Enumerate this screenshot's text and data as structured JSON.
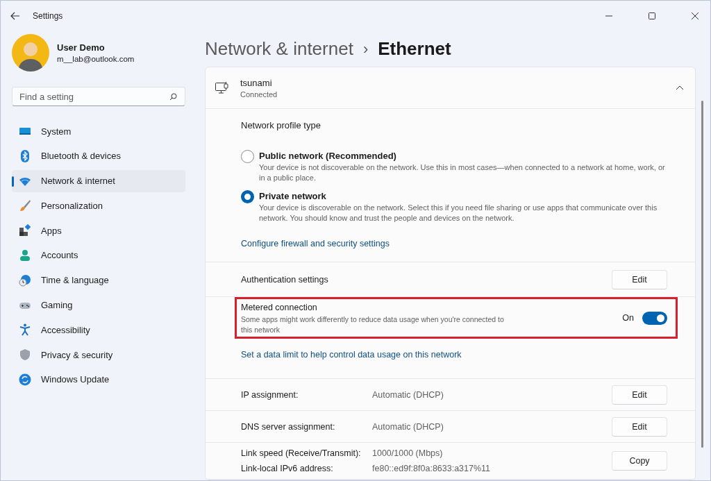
{
  "window": {
    "title": "Settings"
  },
  "user": {
    "name": "User Demo",
    "email": "m__lab@outlook.com"
  },
  "search": {
    "placeholder": "Find a setting"
  },
  "nav": [
    {
      "kind": "system",
      "label": "System",
      "selected": false
    },
    {
      "kind": "bluetooth",
      "label": "Bluetooth & devices",
      "selected": false
    },
    {
      "kind": "network",
      "label": "Network & internet",
      "selected": true
    },
    {
      "kind": "personalization",
      "label": "Personalization",
      "selected": false
    },
    {
      "kind": "apps",
      "label": "Apps",
      "selected": false
    },
    {
      "kind": "accounts",
      "label": "Accounts",
      "selected": false
    },
    {
      "kind": "time",
      "label": "Time & language",
      "selected": false
    },
    {
      "kind": "gaming",
      "label": "Gaming",
      "selected": false
    },
    {
      "kind": "accessibility",
      "label": "Accessibility",
      "selected": false
    },
    {
      "kind": "privacy",
      "label": "Privacy & security",
      "selected": false
    },
    {
      "kind": "update",
      "label": "Windows Update",
      "selected": false
    }
  ],
  "breadcrumb": {
    "parent": "Network & internet",
    "separator": "›",
    "current": "Ethernet"
  },
  "network": {
    "name": "tsunami",
    "status": "Connected",
    "expanded": true
  },
  "profile": {
    "heading": "Network profile type",
    "options": [
      {
        "label": "Public network (Recommended)",
        "description": "Your device is not discoverable on the network. Use this in most cases—when connected to a network at home, work, or in a public place.",
        "selected": false
      },
      {
        "label": "Private network",
        "description": "Your device is discoverable on the network. Select this if you need file sharing or use apps that communicate over this network. You should know and trust the people and devices on the network.",
        "selected": true
      }
    ],
    "link": "Configure firewall and security settings"
  },
  "auth": {
    "label": "Authentication settings",
    "button": "Edit"
  },
  "metered": {
    "label": "Metered connection",
    "description": "Some apps might work differently to reduce data usage when you're connected to this network",
    "state_label": "On",
    "on": true,
    "highlighted": true
  },
  "data_limit_link": "Set a data limit to help control data usage on this network",
  "properties": [
    {
      "rows": [
        {
          "label": "IP assignment:",
          "value": "Automatic (DHCP)"
        }
      ],
      "button": "Edit"
    },
    {
      "rows": [
        {
          "label": "DNS server assignment:",
          "value": "Automatic (DHCP)"
        }
      ],
      "button": "Edit"
    },
    {
      "rows": [
        {
          "label": "Link speed (Receive/Transmit):",
          "value": "1000/1000 (Mbps)"
        },
        {
          "label": "Link-local IPv6 address:",
          "value": "fe80::ed9f:8f0a:8633:a317%11"
        }
      ],
      "button": "Copy"
    }
  ]
}
